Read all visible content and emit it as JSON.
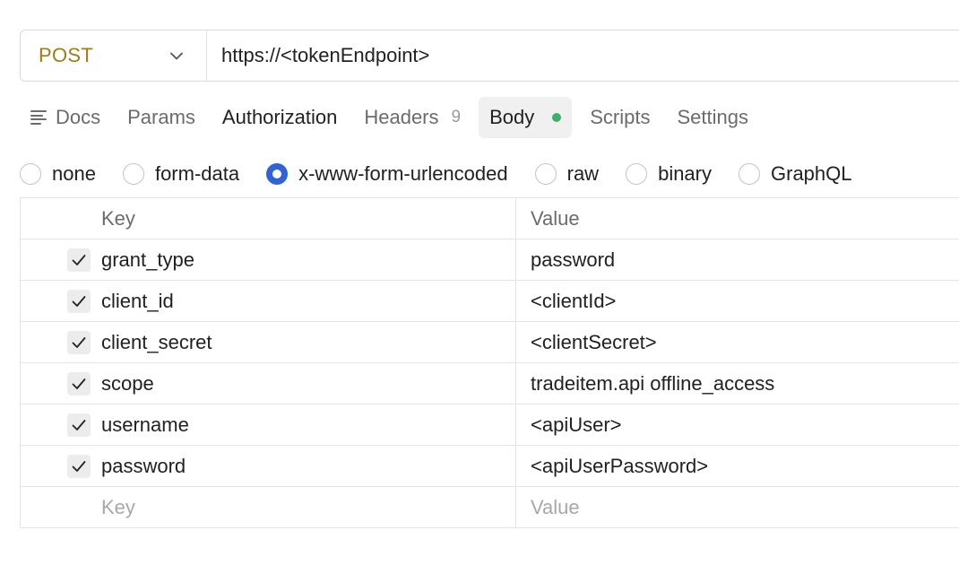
{
  "request": {
    "method": "POST",
    "url": "https://<tokenEndpoint>"
  },
  "tabs": [
    {
      "label": "Docs"
    },
    {
      "label": "Params"
    },
    {
      "label": "Authorization"
    },
    {
      "label": "Headers",
      "badge": "9"
    },
    {
      "label": "Body",
      "active": true
    },
    {
      "label": "Scripts"
    },
    {
      "label": "Settings"
    }
  ],
  "body_types": [
    {
      "label": "none"
    },
    {
      "label": "form-data"
    },
    {
      "label": "x-www-form-urlencoded",
      "selected": true
    },
    {
      "label": "raw"
    },
    {
      "label": "binary"
    },
    {
      "label": "GraphQL"
    }
  ],
  "table": {
    "headers": {
      "key": "Key",
      "value": "Value"
    },
    "rows": [
      {
        "key": "grant_type",
        "value": "password",
        "checked": true
      },
      {
        "key": "client_id",
        "value": "<clientId>",
        "checked": true
      },
      {
        "key": "client_secret",
        "value": "<clientSecret>",
        "checked": true
      },
      {
        "key": "scope",
        "value": "tradeitem.api offline_access",
        "checked": true
      },
      {
        "key": "username",
        "value": "<apiUser>",
        "checked": true
      },
      {
        "key": "password",
        "value": "<apiUserPassword>",
        "checked": true
      }
    ],
    "placeholder": {
      "key": "Key",
      "value": "Value"
    }
  },
  "colors": {
    "method": "#a07c18",
    "radio_selected": "#2f63d6",
    "body_dot": "#3fae6a"
  }
}
